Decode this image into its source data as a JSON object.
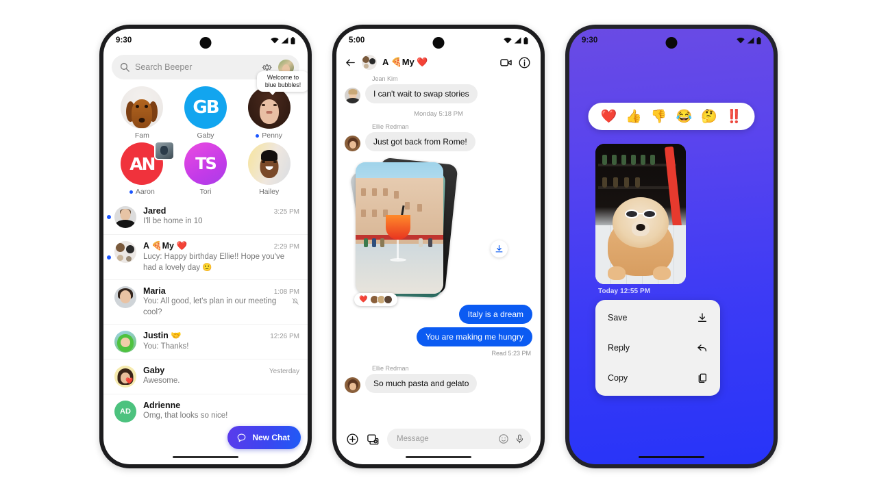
{
  "phone1": {
    "status": {
      "time": "9:30",
      "wifi_icon": "wifi-icon",
      "signal_icon": "signal-icon",
      "battery_icon": "battery-icon"
    },
    "search": {
      "placeholder": "Search Beeper",
      "search_icon": "search-icon",
      "settings_icon": "gear-icon",
      "avatar": "profile-avatar"
    },
    "pinned": [
      {
        "name": "Fam",
        "unread": false,
        "avatar": "fam-dog-avatar",
        "initials": ""
      },
      {
        "name": "Gaby",
        "unread": false,
        "avatar": "gaby-initials-avatar",
        "initials": "GB"
      },
      {
        "name": "Penny",
        "unread": true,
        "avatar": "penny-photo-avatar",
        "initials": "",
        "tooltip": "Welcome to blue bubbles!"
      },
      {
        "name": "Aaron",
        "unread": true,
        "avatar": "aaron-initials-avatar",
        "initials": "AN"
      },
      {
        "name": "Tori",
        "unread": false,
        "avatar": "tori-initials-avatar",
        "initials": "TS"
      },
      {
        "name": "Hailey",
        "unread": false,
        "avatar": "hailey-photo-avatar",
        "initials": ""
      }
    ],
    "chats": [
      {
        "name": "Jared",
        "time": "3:25 PM",
        "preview": "I'll be home in 10",
        "unread": true,
        "muted": false,
        "avatar": "jared-avatar"
      },
      {
        "name": "A 🍕My ❤️",
        "time": "2:29 PM",
        "preview": "Lucy: Happy birthday Ellie!! Hope you've had a lovely day  🙂",
        "unread": true,
        "muted": false,
        "avatar": "group-avatar"
      },
      {
        "name": "Maria",
        "time": "1:08 PM",
        "preview": "You: All good, let's plan in our meeting cool?",
        "unread": false,
        "muted": true,
        "avatar": "maria-avatar"
      },
      {
        "name": "Justin 🤝",
        "time": "12:26 PM",
        "preview": "You: Thanks!",
        "unread": false,
        "muted": false,
        "avatar": "justin-avatar"
      },
      {
        "name": "Gaby",
        "time": "Yesterday",
        "preview": "Awesome.",
        "unread": false,
        "muted": false,
        "avatar": "gaby-row-avatar"
      },
      {
        "name": "Adrienne",
        "time": "",
        "preview": "Omg, that looks so nice!",
        "unread": false,
        "muted": false,
        "avatar": "adrienne-initials-avatar",
        "initials": "AD"
      }
    ],
    "new_chat_button": {
      "label": "New Chat",
      "icon": "chat-bubble-icon"
    }
  },
  "phone2": {
    "status": {
      "time": "5:00"
    },
    "header": {
      "back_icon": "back-arrow-icon",
      "title": "A 🍕My ❤️",
      "video_icon": "video-call-icon",
      "info_icon": "info-icon",
      "avatar": "group-avatar"
    },
    "messages": [
      {
        "type": "incoming",
        "sender": "Jean Kim",
        "text": "I can't wait to swap stories"
      },
      {
        "type": "daystamp",
        "text": "Monday 5:18 PM"
      },
      {
        "type": "incoming",
        "sender": "Ellie Redman",
        "text": "Just got back from Rome!"
      },
      {
        "type": "photo-stack",
        "reaction": "❤️",
        "reaction_count_icon": "reactor-avatars",
        "download_icon": "download-icon"
      },
      {
        "type": "outgoing",
        "text": "Italy is a dream"
      },
      {
        "type": "outgoing",
        "text": "You are making me hungry"
      },
      {
        "type": "receipt",
        "text": "Read  5:23 PM"
      },
      {
        "type": "incoming",
        "sender": "Ellie Redman",
        "text": "So much pasta and gelato"
      }
    ],
    "composer": {
      "placeholder": "Message",
      "plus_icon": "plus-circle-icon",
      "gallery_icon": "photo-camera-icon",
      "emoji_icon": "emoji-icon",
      "mic_icon": "microphone-icon"
    }
  },
  "phone3": {
    "status": {
      "time": "9:30"
    },
    "reactions": [
      "❤️",
      "👍",
      "👎",
      "😂",
      "🤔",
      "‼️"
    ],
    "photo": {
      "alt": "chow-chow-dog-with-sunglasses"
    },
    "timestamp": "Today  12:55 PM",
    "menu": [
      {
        "label": "Save",
        "icon": "download-icon"
      },
      {
        "label": "Reply",
        "icon": "reply-arrow-icon"
      },
      {
        "label": "Copy",
        "icon": "copy-icon"
      }
    ]
  },
  "colors": {
    "accent_blue": "#0B5BF2",
    "unread_dot": "#1A55FF",
    "new_chat_gradient_from": "#5B3BEB",
    "new_chat_gradient_to": "#1F5BF6",
    "phone3_bg_from": "#6A4BE4",
    "phone3_bg_to": "#2734F8",
    "gaby_avatar": "#12A5EF",
    "aaron_avatar": "#F0323C",
    "tori_avatar": "#C43BE8",
    "adrienne_avatar": "#4CC27E",
    "bubble_in": "#EDEDED"
  }
}
